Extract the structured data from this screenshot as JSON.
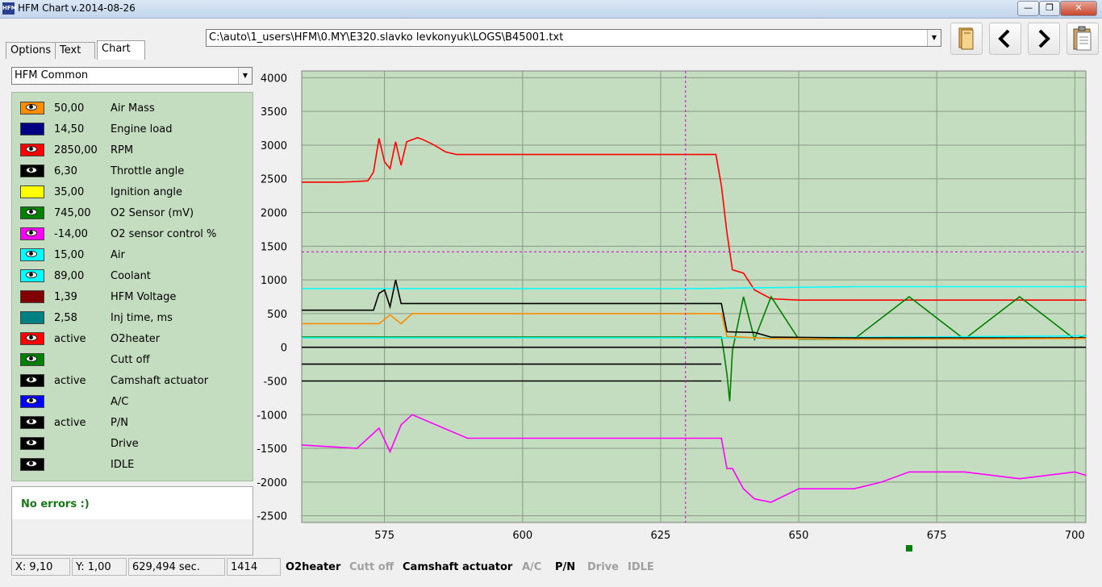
{
  "window": {
    "title": "HFM Chart",
    "version": "v.2014-08-26",
    "minimize": "—",
    "maximize": "❐",
    "close": "✕"
  },
  "tabs": [
    {
      "label": "Options"
    },
    {
      "label": "Text"
    },
    {
      "label": "Chart"
    }
  ],
  "file_path": "C:\\auto\\1_users\\HFM\\0.MY\\E320.slavko levkonyuk\\LOGS\\B45001.txt",
  "preset": "HFM Common",
  "legend": [
    {
      "value": "50,00",
      "name": "Air Mass",
      "color": "#ff8c00",
      "eye": true
    },
    {
      "value": "14,50",
      "name": "Engine load",
      "color": "#000080",
      "eye": false
    },
    {
      "value": "2850,00",
      "name": "RPM",
      "color": "#ff0000",
      "eye": true
    },
    {
      "value": "6,30",
      "name": "Throttle angle",
      "color": "#000000",
      "eye": true
    },
    {
      "value": "35,00",
      "name": "Ignition angle",
      "color": "#ffff00",
      "eye": false
    },
    {
      "value": "745,00",
      "name": "O2 Sensor (mV)",
      "color": "#008000",
      "eye": true
    },
    {
      "value": "-14,00",
      "name": "O2 sensor control %",
      "color": "#ff00ff",
      "eye": true
    },
    {
      "value": "15,00",
      "name": "Air",
      "color": "#00ffff",
      "eye": true
    },
    {
      "value": "89,00",
      "name": "Coolant",
      "color": "#00ffff",
      "eye": true
    },
    {
      "value": "1,39",
      "name": "HFM Voltage",
      "color": "#800000",
      "eye": false
    },
    {
      "value": "2,58",
      "name": "Inj time, ms",
      "color": "#008080",
      "eye": false
    },
    {
      "value": "active",
      "name": "O2heater",
      "color": "#ff0000",
      "eye": true
    },
    {
      "value": "",
      "name": "Cutt off",
      "color": "#008000",
      "eye": true
    },
    {
      "value": "active",
      "name": "Camshaft actuator",
      "color": "#000000",
      "eye": true
    },
    {
      "value": "",
      "name": "A/C",
      "color": "#0000ff",
      "eye": true
    },
    {
      "value": "active",
      "name": "P/N",
      "color": "#000000",
      "eye": true
    },
    {
      "value": "",
      "name": "Drive",
      "color": "#000000",
      "eye": true
    },
    {
      "value": "",
      "name": "IDLE",
      "color": "#000000",
      "eye": true
    }
  ],
  "errors": "No errors :)",
  "status": {
    "x": "X: 9,10",
    "y": "Y: 1,00",
    "time": "629,494 sec.",
    "count": "1414",
    "flags": [
      {
        "label": "O2heater",
        "active": true
      },
      {
        "label": "Cutt off",
        "active": false
      },
      {
        "label": "Camshaft actuator",
        "active": true
      },
      {
        "label": "A/C",
        "active": false
      },
      {
        "label": "P/N",
        "active": true
      },
      {
        "label": "Drive",
        "active": false
      },
      {
        "label": "IDLE",
        "active": false
      }
    ]
  },
  "chart_data": {
    "type": "line",
    "xlim": [
      560,
      702
    ],
    "ylim": [
      -2600,
      4100
    ],
    "x_ticks": [
      575,
      600,
      625,
      650,
      675,
      700
    ],
    "y_ticks": [
      -2500,
      -2000,
      -1500,
      -1000,
      -500,
      0,
      500,
      1000,
      1500,
      2000,
      2500,
      3000,
      3500,
      4000
    ],
    "grid": true,
    "background": "#c4dcbf",
    "cursor": {
      "x": 629.5,
      "y": 1415
    },
    "series": [
      {
        "color": "#ff0000",
        "x": [
          560,
          567,
          570,
          572,
          573,
          574,
          575,
          576,
          577,
          578,
          579,
          580,
          581,
          582,
          584,
          586,
          588,
          590,
          600,
          610,
          620,
          630,
          635,
          636,
          637,
          638,
          640,
          642,
          645,
          650,
          660,
          670,
          680,
          690,
          700,
          702
        ],
        "y": [
          2450,
          2450,
          2460,
          2470,
          2600,
          3100,
          2750,
          2650,
          3050,
          2700,
          3050,
          3080,
          3110,
          3080,
          3000,
          2900,
          2860,
          2860,
          2860,
          2860,
          2860,
          2860,
          2860,
          2400,
          1700,
          1150,
          1100,
          850,
          720,
          700,
          700,
          700,
          700,
          700,
          700,
          700
        ]
      },
      {
        "color": "#008000",
        "x": [
          560,
          636,
          636.5,
          637,
          637.5,
          638,
          640,
          642,
          645,
          650,
          660,
          670,
          680,
          690,
          700,
          702
        ],
        "y": [
          150,
          150,
          -100,
          -400,
          -800,
          -50,
          750,
          120,
          750,
          120,
          120,
          750,
          120,
          750,
          120,
          180
        ]
      },
      {
        "color": "#ff00ff",
        "x": [
          560,
          570,
          574,
          576,
          578,
          580,
          590,
          600,
          610,
          620,
          630,
          636,
          637,
          638,
          640,
          642,
          645,
          650,
          660,
          665,
          670,
          680,
          690,
          700,
          702
        ],
        "y": [
          -1450,
          -1500,
          -1200,
          -1550,
          -1150,
          -1000,
          -1350,
          -1350,
          -1350,
          -1350,
          -1350,
          -1350,
          -1800,
          -1800,
          -2100,
          -2250,
          -2300,
          -2100,
          -2100,
          -2000,
          -1850,
          -1850,
          -1950,
          -1850,
          -1900
        ]
      },
      {
        "color": "#00ffff",
        "x": [
          560,
          600,
          630,
          660,
          702
        ],
        "y": [
          870,
          870,
          870,
          900,
          900
        ]
      },
      {
        "color": "#00ffff",
        "x": [
          560,
          600,
          640,
          670,
          702
        ],
        "y": [
          140,
          140,
          140,
          150,
          170
        ]
      },
      {
        "color": "#000000",
        "x": [
          560,
          573,
          574,
          575,
          576,
          577,
          578,
          580,
          600,
          620,
          636,
          637,
          642,
          645,
          660,
          680,
          702
        ],
        "y": [
          550,
          550,
          800,
          850,
          600,
          1000,
          650,
          650,
          650,
          650,
          650,
          230,
          220,
          150,
          140,
          140,
          140
        ]
      },
      {
        "color": "#ff8c00",
        "x": [
          560,
          574,
          576,
          578,
          580,
          600,
          636,
          637,
          645,
          660,
          702
        ],
        "y": [
          350,
          350,
          480,
          350,
          500,
          500,
          500,
          160,
          130,
          120,
          130
        ]
      },
      {
        "color": "#000000",
        "x": [
          560,
          702
        ],
        "y": [
          0,
          0
        ]
      },
      {
        "color": "#000000",
        "x": [
          560,
          636
        ],
        "y": [
          -250,
          -250
        ]
      },
      {
        "color": "#000000",
        "x": [
          560,
          636
        ],
        "y": [
          -500,
          -500
        ]
      }
    ]
  }
}
